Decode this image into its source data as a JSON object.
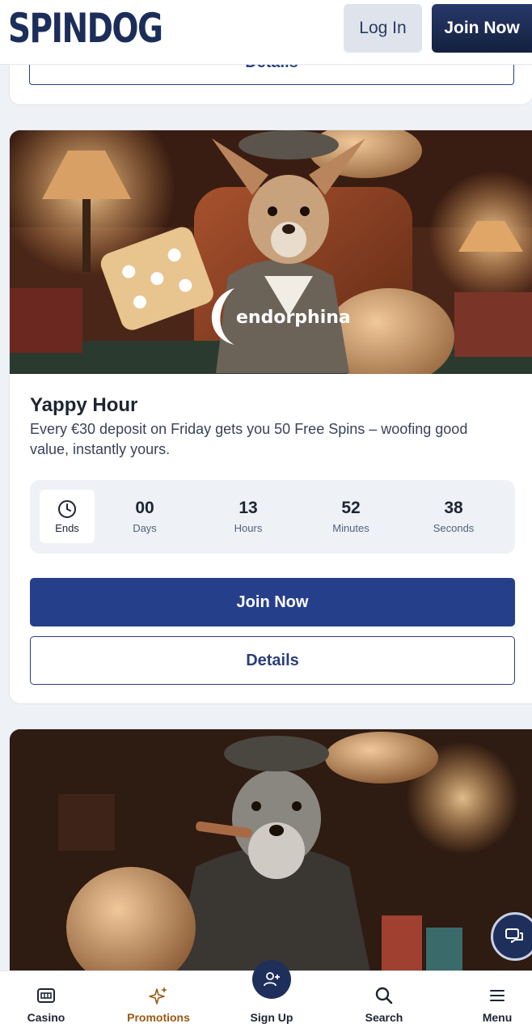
{
  "header": {
    "logo": "SPINDOG",
    "login_label": "Log In",
    "join_label": "Join Now"
  },
  "previous_card": {
    "details_label": "Details"
  },
  "promo": {
    "provider_logo_text": "endorphina",
    "title": "Yappy Hour",
    "description": "Every €30 deposit on Friday gets you 50 Free Spins – woofing good value, instantly yours.",
    "countdown": {
      "ends_label": "Ends",
      "units": [
        {
          "value": "00",
          "label": "Days"
        },
        {
          "value": "13",
          "label": "Hours"
        },
        {
          "value": "52",
          "label": "Minutes"
        },
        {
          "value": "38",
          "label": "Seconds"
        }
      ]
    },
    "join_label": "Join Now",
    "details_label": "Details"
  },
  "bottom_nav": {
    "items": [
      {
        "label": "Casino",
        "icon": "slot-machine-icon"
      },
      {
        "label": "Promotions",
        "icon": "sparkles-icon",
        "active": true
      },
      {
        "label": "Sign Up",
        "icon": "add-user-icon"
      },
      {
        "label": "Search",
        "icon": "search-icon"
      },
      {
        "label": "Menu",
        "icon": "hamburger-menu-icon"
      }
    ]
  },
  "colors": {
    "brand_navy": "#1c2d5a",
    "primary_button": "#263f8b",
    "active_nav": "#9a5a12"
  }
}
